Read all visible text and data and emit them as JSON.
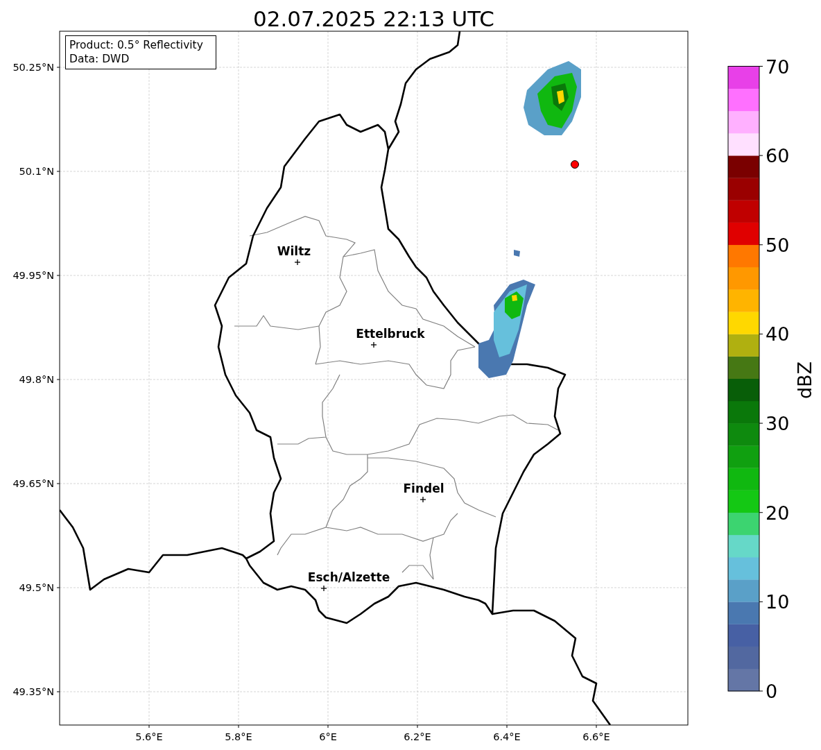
{
  "title": "02.07.2025 22:13 UTC",
  "info_box": [
    "Product: 0.5° Reflectivity",
    "Data: DWD"
  ],
  "map": {
    "yticks": [
      "50.25°N",
      "50.1°N",
      "49.95°N",
      "49.8°N",
      "49.65°N",
      "49.5°N",
      "49.35°N"
    ],
    "xticks": [
      "5.6°E",
      "5.8°E",
      "6°E",
      "6.2°E",
      "6.4°E",
      "6.6°E"
    ],
    "cities": [
      {
        "name": "Wiltz"
      },
      {
        "name": "Ettelbruck"
      },
      {
        "name": "Findel"
      },
      {
        "name": "Esch/Alzette"
      }
    ]
  },
  "colorbar": {
    "label": "dBZ",
    "ticks": [
      "70",
      "60",
      "50",
      "40",
      "30",
      "20",
      "10",
      "0"
    ],
    "bands": [
      {
        "color": "#6476a6"
      },
      {
        "color": "#5268a0"
      },
      {
        "color": "#4760a4"
      },
      {
        "color": "#4a78b0"
      },
      {
        "color": "#5aa0c8"
      },
      {
        "color": "#66c0dc"
      },
      {
        "color": "#66d8c8"
      },
      {
        "color": "#3cd470"
      },
      {
        "color": "#14c814"
      },
      {
        "color": "#10b810"
      },
      {
        "color": "#10a010"
      },
      {
        "color": "#0e8a0e"
      },
      {
        "color": "#0a780a"
      },
      {
        "color": "#085e08"
      },
      {
        "color": "#467814"
      },
      {
        "color": "#b0b010"
      },
      {
        "color": "#ffd800"
      },
      {
        "color": "#ffb400"
      },
      {
        "color": "#ff9800"
      },
      {
        "color": "#ff7800"
      },
      {
        "color": "#e00000"
      },
      {
        "color": "#c00000"
      },
      {
        "color": "#9a0000"
      },
      {
        "color": "#7a0000"
      },
      {
        "color": "#ffe0ff"
      },
      {
        "color": "#ffb0ff"
      },
      {
        "color": "#ff70ff"
      },
      {
        "color": "#e840e8"
      }
    ]
  }
}
